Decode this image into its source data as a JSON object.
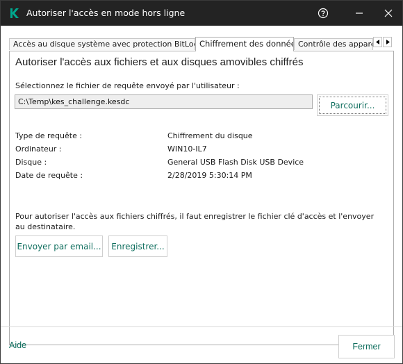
{
  "window": {
    "title": "Autoriser l'accès en mode hors ligne",
    "icons": {
      "logo": "kaspersky-k-icon",
      "help": "help-circle-icon",
      "minimize": "minimize-icon",
      "close": "close-icon"
    }
  },
  "tabs": [
    {
      "label": "Accès au disque système avec protection BitLocker",
      "active": false
    },
    {
      "label": "Chiffrement des données",
      "active": true
    },
    {
      "label": "Contrôle des apparei",
      "active": false
    }
  ],
  "panel": {
    "heading": "Autoriser l'accès aux fichiers et aux disques amovibles chiffrés",
    "select_label": "Sélectionnez le fichier de requête envoyé par l'utilisateur :",
    "file_path": "C:\\Temp\\kes_challenge.kesdc",
    "browse_label": "Parcourir...",
    "info": [
      {
        "label": "Type de requête :",
        "value": "Chiffrement du disque"
      },
      {
        "label": "Ordinateur :",
        "value": "WIN10-IL7"
      },
      {
        "label": "Disque :",
        "value": "General USB Flash Disk USB Device"
      },
      {
        "label": "Date de requête :",
        "value": "2/28/2019 5:30:14 PM"
      }
    ],
    "note": "Pour autoriser l'accès aux fichiers chiffrés, il faut enregistrer le fichier clé d'accès et l'envoyer au destinataire.",
    "email_label": "Envoyer par email...",
    "save_label": "Enregistrer..."
  },
  "footer": {
    "help_label": "Aide",
    "close_label": "Fermer"
  },
  "colors": {
    "accent": "#0f6e5e",
    "titlebar": "#232323",
    "brand": "#00a88e"
  }
}
